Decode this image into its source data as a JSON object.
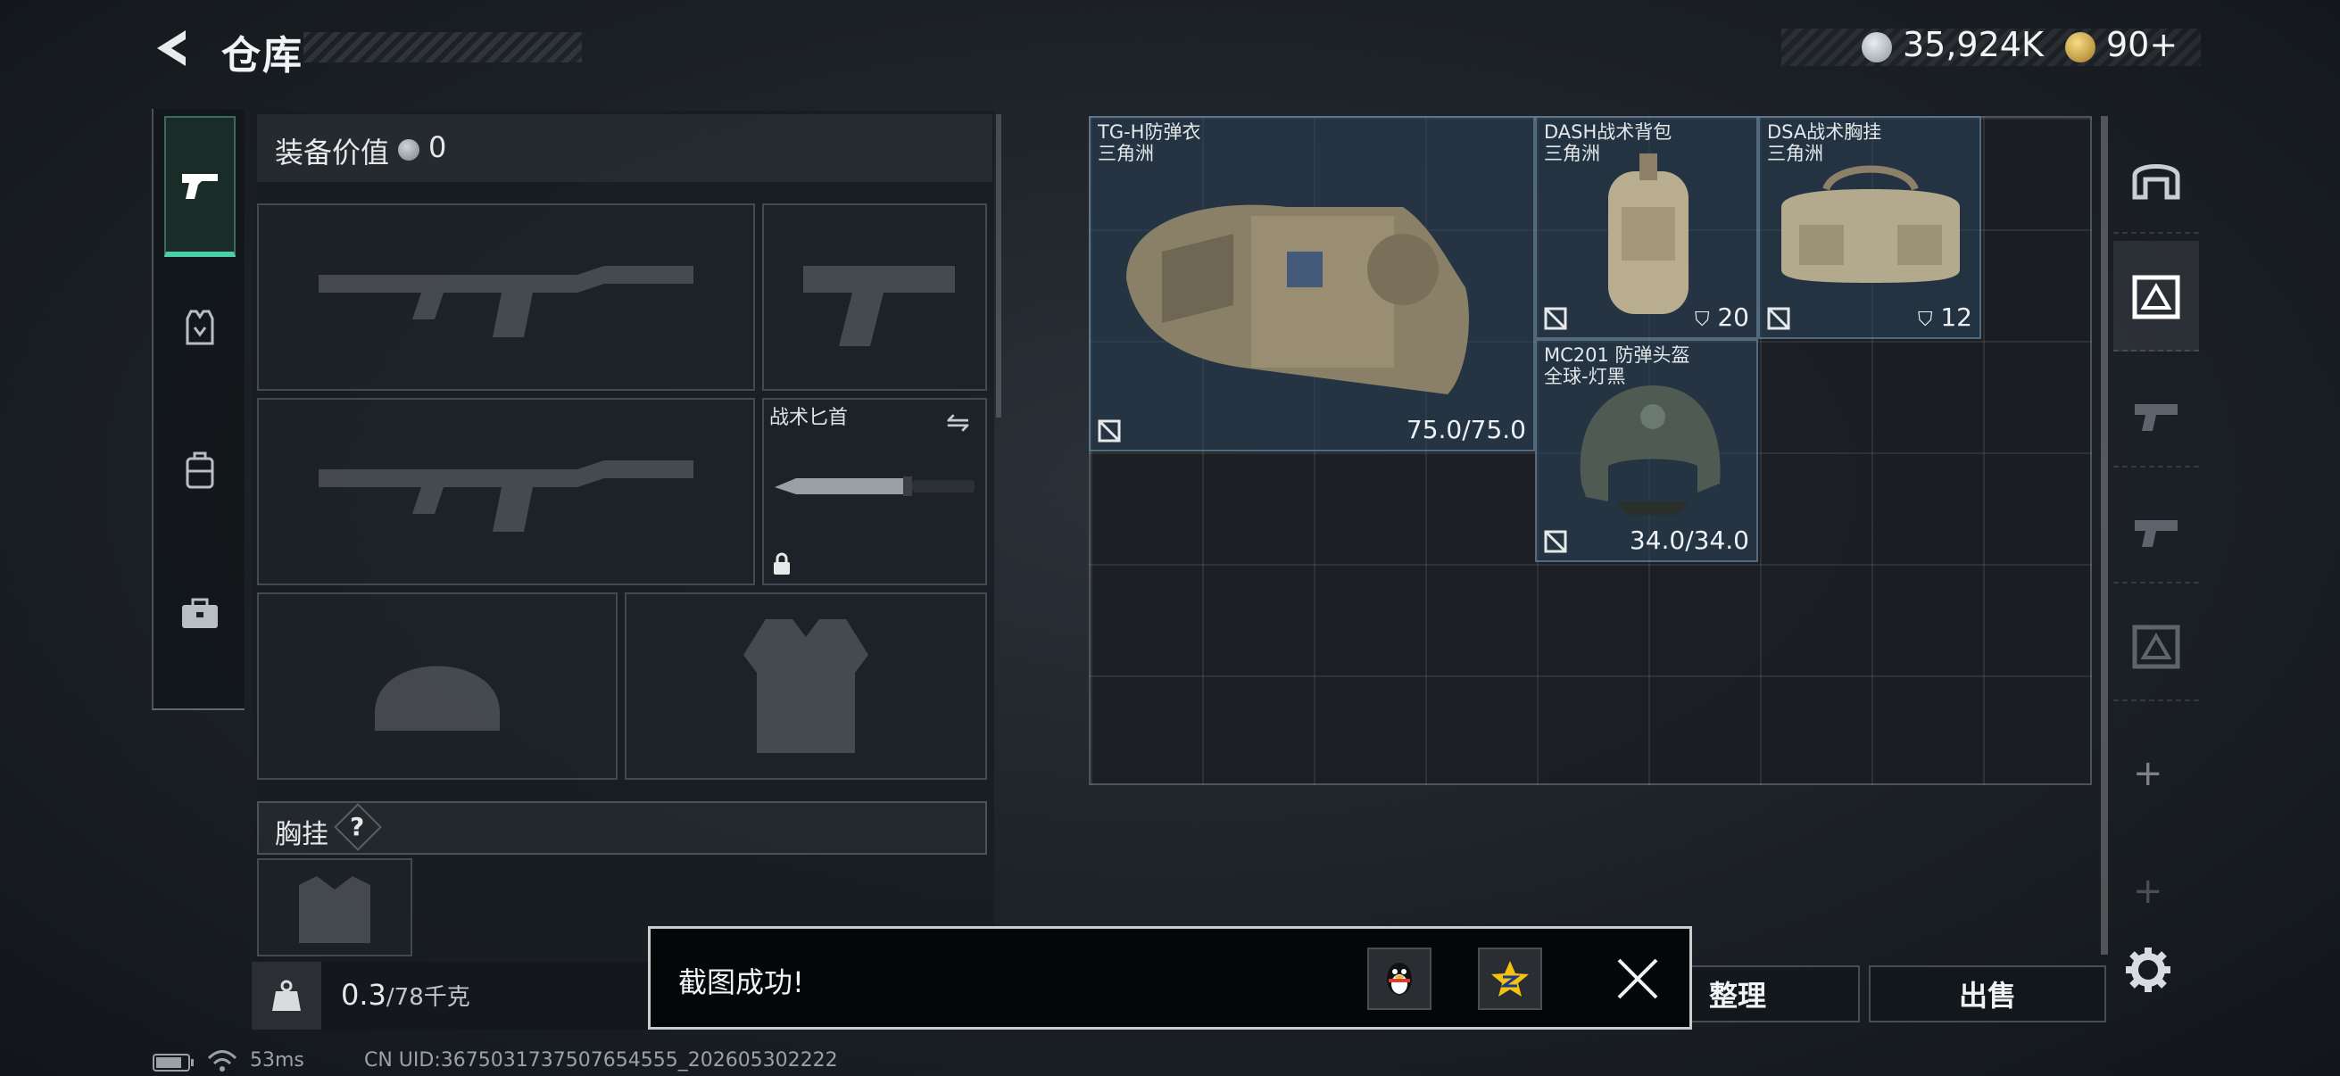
{
  "header": {
    "title": "仓库",
    "silver_amount": "35,924K",
    "gold_amount": "90+"
  },
  "left_tabs": [
    {
      "name": "weapons",
      "icon": "pistol-icon",
      "active": true
    },
    {
      "name": "armor",
      "icon": "vest-icon",
      "active": false
    },
    {
      "name": "backpack",
      "icon": "backpack-icon",
      "active": false
    },
    {
      "name": "case",
      "icon": "briefcase-icon",
      "active": false
    }
  ],
  "equipment": {
    "value_label": "装备价值",
    "value": "0",
    "knife_label": "战术匕首",
    "chest_label": "胸挂",
    "chest_help": "?",
    "weight_value": "0.3",
    "weight_max": "/78千克"
  },
  "stash_items": [
    {
      "name": "TG-H防弹衣",
      "region": "三角洲",
      "durability": "75.0/75.0"
    },
    {
      "name": "DASH战术背包",
      "region": "三角洲",
      "capacity": "20"
    },
    {
      "name": "DSA战术胸挂",
      "region": "三角洲",
      "capacity": "12"
    },
    {
      "name": "MC201 防弹头盔",
      "region": "全球-灯黑",
      "durability": "34.0/34.0"
    }
  ],
  "buttons": {
    "sort": "整理",
    "sell": "出售"
  },
  "toast": {
    "message": "截图成功!"
  },
  "status_bar": {
    "ping": "53ms",
    "uid": "CN UID:3675031737507654555_202605302222"
  },
  "colors": {
    "active_tab_accent": "#49d1a5",
    "item_bg": "#2d465c"
  }
}
